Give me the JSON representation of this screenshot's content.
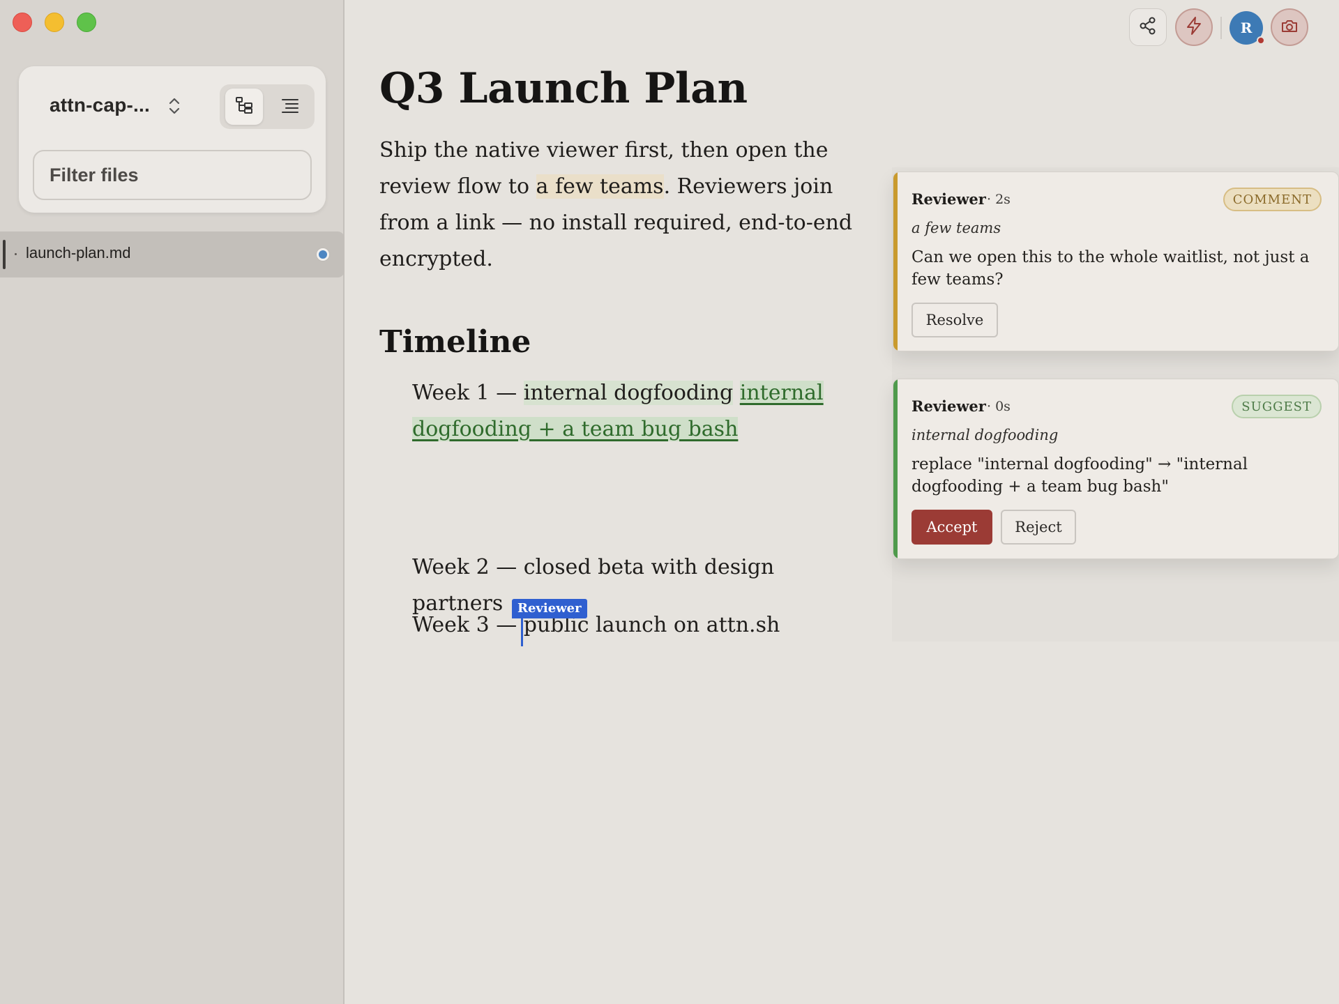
{
  "sidebar": {
    "workspace_name": "attn-cap-...",
    "filter_placeholder": "Filter files",
    "files": [
      {
        "name": "launch-plan.md",
        "active": true,
        "status_color": "#4d86c2"
      }
    ]
  },
  "toolbar": {
    "avatar_initial": "R"
  },
  "document": {
    "title": "Q3 Launch Plan",
    "paragraph": {
      "before": "Ship the native viewer first, then open the review flow to ",
      "highlight": "a few teams",
      "after": ". Reviewers join from a link — no install required, end-to-end encrypted."
    },
    "timeline_heading": "Timeline",
    "weeks": [
      {
        "prefix": "Week 1 — ",
        "deleted": "internal dogfooding",
        "inserted": "internal dogfooding + a team bug bash"
      },
      {
        "text": "Week 2 — closed beta with design partners"
      },
      {
        "prefix": "Week 3 — ",
        "text": "public launch on attn.sh"
      }
    ],
    "cursor_label": "Reviewer"
  },
  "comments": [
    {
      "author": "Reviewer",
      "time": "· 2s",
      "badge": "COMMENT",
      "quote": "a few teams",
      "body": "Can we open this to the whole waitlist, not just a few teams?",
      "actions": {
        "resolve": "Resolve"
      }
    },
    {
      "author": "Reviewer",
      "time": "· 0s",
      "badge": "SUGGEST",
      "quote": "internal dogfooding",
      "body": "replace \"internal dogfooding\" → \"internal dogfooding + a team bug bash\"",
      "actions": {
        "accept": "Accept",
        "reject": "Reject"
      }
    }
  ],
  "colors": {
    "accent_primary": "#9b3b35",
    "comment_accent": "#c99a2e",
    "suggest_accent": "#4f9a4c",
    "cursor": "#2f5fd0",
    "avatar": "#3d7ab5"
  },
  "icons": {
    "workspace_switch": "chevron-up-down-icon",
    "tree_view": "tree-view-icon",
    "outline_view": "outline-list-icon",
    "share": "share-icon",
    "bolt": "lightning-bolt-icon",
    "camera": "camera-icon"
  }
}
